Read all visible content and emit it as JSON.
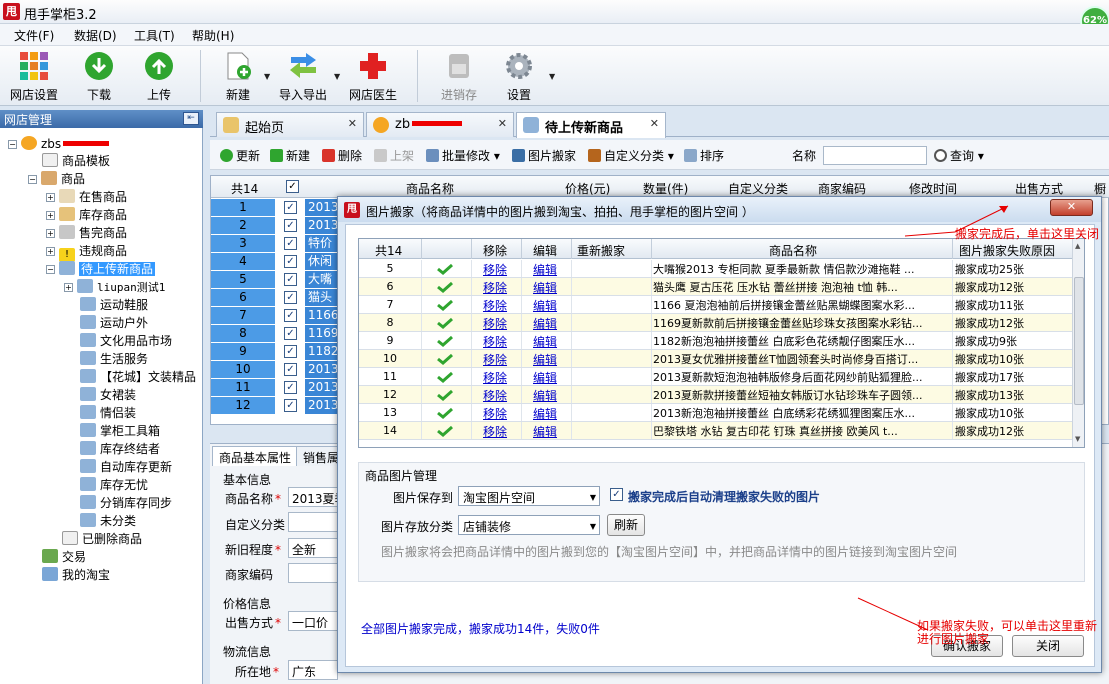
{
  "app": {
    "logo_char": "甩",
    "title": "甩手掌柜3.2",
    "battery": "62%"
  },
  "menu": [
    "文件(F)",
    "数据(D)",
    "工具(T)",
    "帮助(H)"
  ],
  "toolbar": {
    "shop_settings": "网店设置",
    "download": "下载",
    "upload": "上传",
    "new": "新建",
    "import_export": "导入导出",
    "doctor": "网店医生",
    "inventory": "进销存",
    "settings": "设置"
  },
  "left_panel": {
    "title": "网店管理",
    "shop": "zbs",
    "items": [
      "商品模板",
      "商品",
      "在售商品",
      "库存商品",
      "售完商品",
      "违规商品",
      "待上传新商品",
      "liupan测试1",
      "运动鞋服",
      "运动户外",
      "文化用品市场",
      "生活服务",
      "【花城】文装精品",
      "女裙装",
      "情侣装",
      "掌柜工具箱",
      "库存终结者",
      "自动库存更新",
      "库存无忧",
      "分销库存同步",
      "未分类",
      "已删除商品",
      "交易",
      "我的淘宝"
    ]
  },
  "tabs": {
    "start": "起始页",
    "shop": "zb",
    "pending": "待上传新商品"
  },
  "sub_toolbar": {
    "refresh": "更新",
    "new": "新建",
    "delete": "删除",
    "move_up": "上架",
    "batch_edit": "批量修改",
    "image_move": "图片搬家",
    "custom_cat": "自定义分类",
    "sort": "排序",
    "name_label": "名称",
    "query": "查询"
  },
  "bg_table": {
    "headers": {
      "count": "共14",
      "name": "商品名称",
      "price": "价格(元)",
      "qty": "数量(件)",
      "custom": "自定义分类",
      "code": "商家编码",
      "mtime": "修改时间",
      "sell": "出售方式",
      "extra": "橱"
    },
    "rows": [
      {
        "n": "1",
        "t": "2013"
      },
      {
        "n": "2",
        "t": "2013"
      },
      {
        "n": "3",
        "t": "特价"
      },
      {
        "n": "4",
        "t": "休闲"
      },
      {
        "n": "5",
        "t": "大嘴"
      },
      {
        "n": "6",
        "t": "猫头"
      },
      {
        "n": "7",
        "t": "1166"
      },
      {
        "n": "8",
        "t": "1169"
      },
      {
        "n": "9",
        "t": "1182"
      },
      {
        "n": "10",
        "t": "2013"
      },
      {
        "n": "11",
        "t": "2013"
      },
      {
        "n": "12",
        "t": "2013"
      }
    ]
  },
  "bottom": {
    "tab_basic": "商品基本属性",
    "tab_sales": "销售属",
    "basic_info": "基本信息",
    "name_label": "商品名称",
    "name_value": "2013夏季",
    "custom_label": "自定义分类",
    "cond_label": "新旧程度",
    "cond_value": "全新",
    "code_label": "商家编码",
    "price_info": "价格信息",
    "sell_label": "出售方式",
    "sell_value": "一口价",
    "logistics": "物流信息",
    "loc_label": "所在地",
    "loc_value": "广东"
  },
  "dialog": {
    "logo_char": "甩",
    "title": "图片搬家（将商品详情中的图片搬到淘宝、拍拍、甩手掌柜的图片空间 ）",
    "close_glyph": "✕",
    "grid_headers": {
      "count": "共14",
      "remove": "移除",
      "edit": "编辑",
      "remove_again": "重新搬家",
      "name": "商品名称",
      "reason": "图片搬家失败原因"
    },
    "rows": [
      {
        "n": "5",
        "remove": "移除",
        "edit": "编辑",
        "name": "大嘴猴2013 专柜同款 夏季最新款 情侣款沙滩拖鞋 ...",
        "reason": "搬家成功25张"
      },
      {
        "n": "6",
        "remove": "移除",
        "edit": "编辑",
        "name": "猫头鹰 夏古压花 压水钻 蕾丝拼接 泡泡袖 t恤 韩...",
        "reason": "搬家成功12张"
      },
      {
        "n": "7",
        "remove": "移除",
        "edit": "编辑",
        "name": "1166 夏泡泡袖前后拼接镶金蕾丝贴黑蝴蝶图案水彩...",
        "reason": "搬家成功11张"
      },
      {
        "n": "8",
        "remove": "移除",
        "edit": "编辑",
        "name": "1169夏新款前后拼接镶金蕾丝贴珍珠女孩图案水彩钻...",
        "reason": "搬家成功12张"
      },
      {
        "n": "9",
        "remove": "移除",
        "edit": "编辑",
        "name": "1182新泡泡袖拼接蕾丝 白底彩色花绣靓仔图案压水...",
        "reason": "搬家成功9张"
      },
      {
        "n": "10",
        "remove": "移除",
        "edit": "编辑",
        "name": "2013夏女优雅拼接蕾丝T恤圆领套头时尚修身百搭订...",
        "reason": "搬家成功10张"
      },
      {
        "n": "11",
        "remove": "移除",
        "edit": "编辑",
        "name": "2013夏新款短泡泡袖韩版修身后面花网纱前贴狐狸脸...",
        "reason": "搬家成功17张"
      },
      {
        "n": "12",
        "remove": "移除",
        "edit": "编辑",
        "name": "2013夏新款拼接蕾丝短袖女韩版订水钻珍珠车子圆领...",
        "reason": "搬家成功13张"
      },
      {
        "n": "13",
        "remove": "移除",
        "edit": "编辑",
        "name": "2013新泡泡袖拼接蕾丝 白底绣彩花绣狐狸图案压水...",
        "reason": "搬家成功10张"
      },
      {
        "n": "14",
        "remove": "移除",
        "edit": "编辑",
        "name": "巴黎铁塔 水钻 复古印花 钉珠 真丝拼接 欧美风 t...",
        "reason": "搬家成功12张"
      }
    ],
    "mgmt_title": "商品图片管理",
    "save_to_label": "图片保存到",
    "save_to_value": "淘宝图片空间",
    "auto_clean_label": "搬家完成后自动清理搬家失败的图片",
    "category_label": "图片存放分类",
    "category_value": "店铺装修",
    "refresh_button": "刷新",
    "hint": "图片搬家将会把商品详情中的图片搬到您的【淘宝图片空间】中，并把商品详情中的图片链接到淘宝图片空间",
    "status": "全部图片搬家完成，搬家成功14件，失败0件",
    "confirm_button": "确认搬家",
    "close_button": "关闭"
  },
  "annotations": {
    "close_hint": "搬家完成后，单击这里关闭",
    "retry_hint_1": "如果搬家失败，可以单击这里重新",
    "retry_hint_2": "进行图片搬家"
  },
  "colors": {
    "accent": "#3399ff",
    "link": "#0000cc",
    "annotation": "#e60000",
    "success_check": "#2fa52f"
  }
}
